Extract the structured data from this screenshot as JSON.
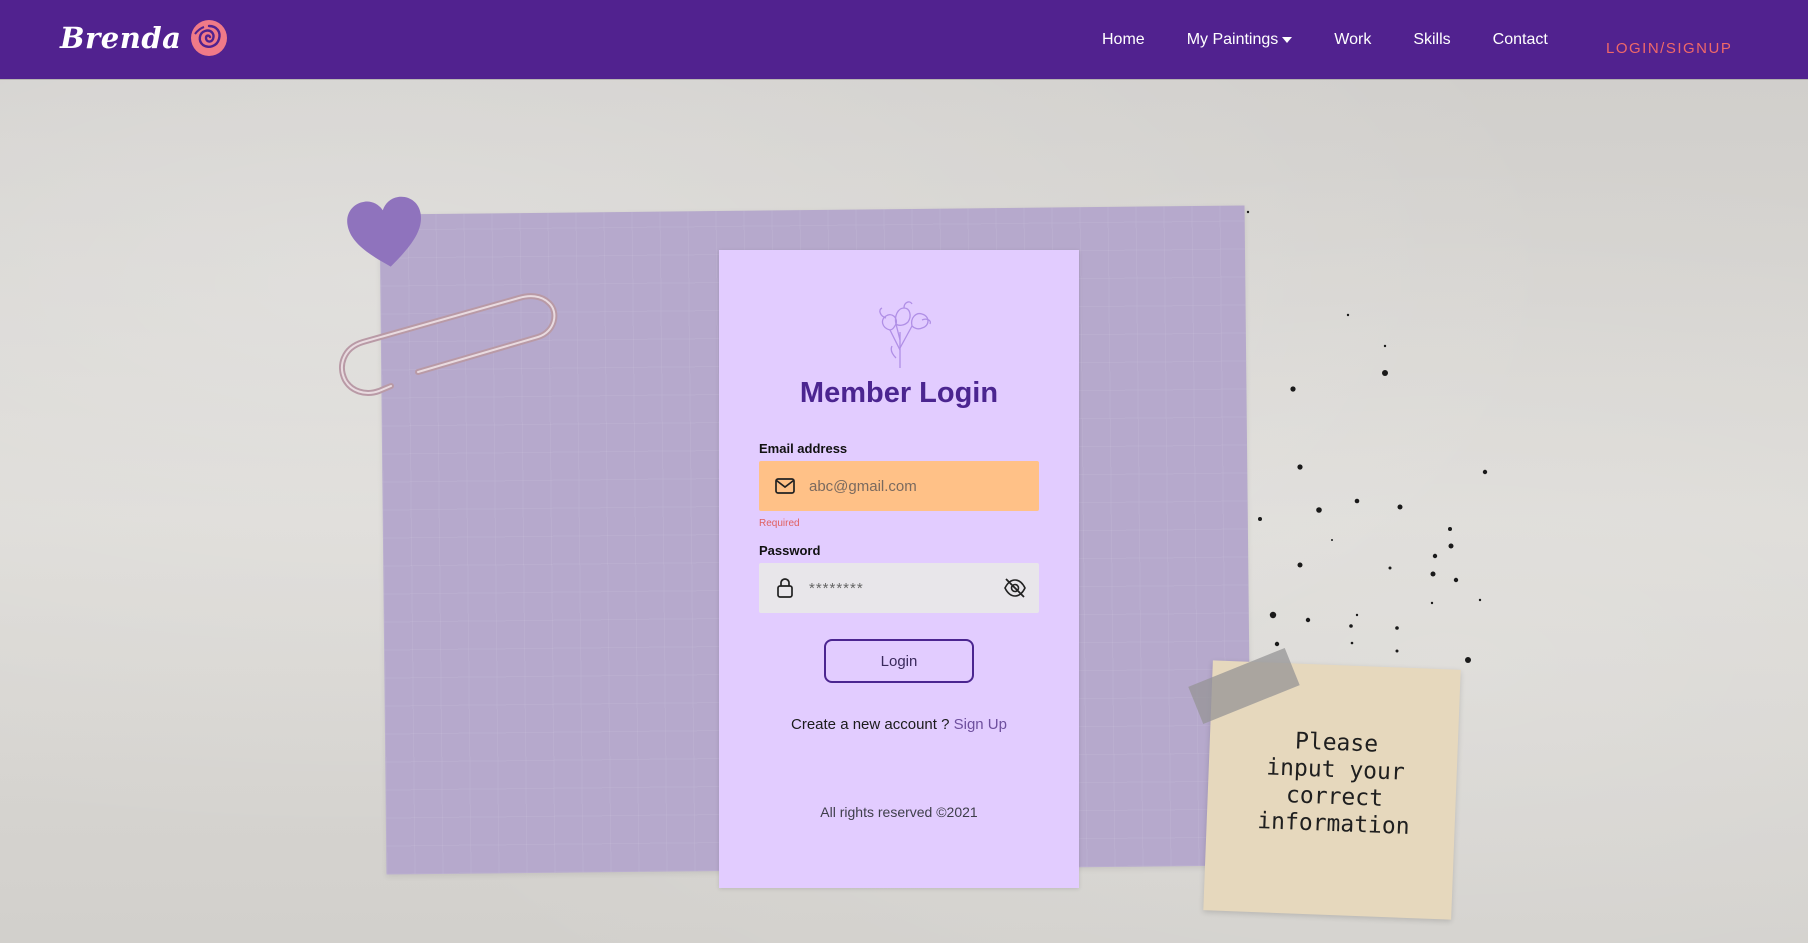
{
  "navbar": {
    "brand": "Brenda",
    "items": [
      {
        "label": "Home"
      },
      {
        "label": "My Paintings"
      },
      {
        "label": "Work"
      },
      {
        "label": "Skills"
      },
      {
        "label": "Contact"
      }
    ],
    "login_signup": "LOGIN/SIGNUP"
  },
  "login": {
    "title": "Member Login",
    "email_label": "Email address",
    "email_placeholder": "abc@gmail.com",
    "required": "Required",
    "password_label": "Password",
    "password_placeholder": "********",
    "button": "Login",
    "create_text": "Create a new account ?",
    "signup_link": "Sign Up",
    "footer": "All rights reserved ©2021"
  },
  "sticky_note": {
    "lines": [
      "Please",
      "input your",
      "correct",
      "information"
    ]
  },
  "colors": {
    "navbar": "#51228f",
    "card": "#e2ccff",
    "email_field": "#ffc187",
    "accent": "#f06868",
    "title": "#4b2590"
  },
  "icons": [
    "rose-logo-icon",
    "caret-down-icon",
    "flower-icon",
    "mail-icon",
    "lock-icon",
    "eye-off-icon",
    "heart-icon",
    "paperclip-icon"
  ]
}
